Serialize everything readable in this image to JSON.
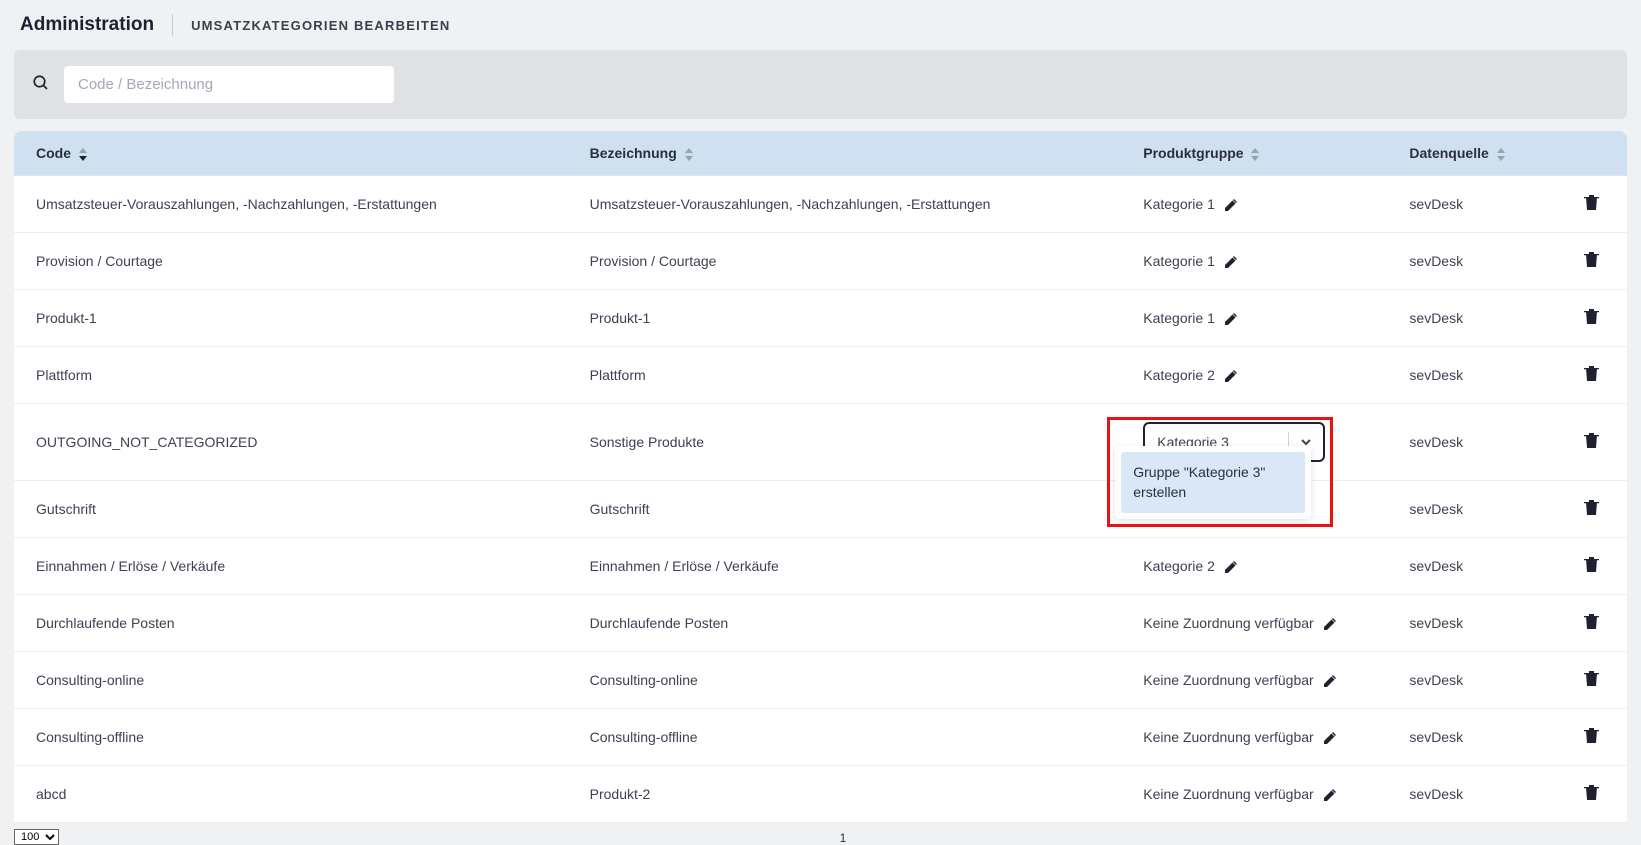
{
  "header": {
    "title": "Administration",
    "breadcrumb": "UMSATZKATEGORIEN BEARBEITEN"
  },
  "search": {
    "placeholder": "Code / Bezeichnung",
    "value": ""
  },
  "columns": {
    "code": "Code",
    "bezeichnung": "Bezeichnung",
    "produktgruppe": "Produktgruppe",
    "datenquelle": "Datenquelle"
  },
  "select": {
    "value": "Kategorie 3",
    "dropdown_option": "Gruppe \"Kategorie 3\" erstellen"
  },
  "rows": [
    {
      "code": "Umsatzsteuer-Vorauszahlungen, -Nachzahlungen, -Erstattungen",
      "bez": "Umsatzsteuer-Vorauszahlungen, -Nachzahlungen, -Erstattungen",
      "group": "Kategorie 1",
      "group_mode": "edit",
      "src": "sevDesk"
    },
    {
      "code": "Provision / Courtage",
      "bez": "Provision / Courtage",
      "group": "Kategorie 1",
      "group_mode": "edit",
      "src": "sevDesk"
    },
    {
      "code": "Produkt-1",
      "bez": "Produkt-1",
      "group": "Kategorie 1",
      "group_mode": "edit",
      "src": "sevDesk"
    },
    {
      "code": "Plattform",
      "bez": "Plattform",
      "group": "Kategorie 2",
      "group_mode": "edit",
      "src": "sevDesk"
    },
    {
      "code": "OUTGOING_NOT_CATEGORIZED",
      "bez": "Sonstige Produkte",
      "group": "Kategorie 3",
      "group_mode": "select",
      "src": "sevDesk"
    },
    {
      "code": "Gutschrift",
      "bez": "Gutschrift",
      "group": "",
      "group_mode": "hidden",
      "src": "sevDesk"
    },
    {
      "code": "Einnahmen / Erlöse / Verkäufe",
      "bez": "Einnahmen / Erlöse / Verkäufe",
      "group": "Kategorie 2",
      "group_mode": "edit",
      "src": "sevDesk"
    },
    {
      "code": "Durchlaufende Posten",
      "bez": "Durchlaufende Posten",
      "group": "Keine Zuordnung verfügbar",
      "group_mode": "edit",
      "src": "sevDesk"
    },
    {
      "code": "Consulting-online",
      "bez": "Consulting-online",
      "group": "Keine Zuordnung verfügbar",
      "group_mode": "edit",
      "src": "sevDesk"
    },
    {
      "code": "Consulting-offline",
      "bez": "Consulting-offline",
      "group": "Keine Zuordnung verfügbar",
      "group_mode": "edit",
      "src": "sevDesk"
    },
    {
      "code": "abcd",
      "bez": "Produkt-2",
      "group": "Keine Zuordnung verfügbar",
      "group_mode": "edit",
      "src": "sevDesk"
    }
  ],
  "pager": {
    "page_size": "100",
    "current_page": "1"
  },
  "highlight": {
    "show": true
  }
}
